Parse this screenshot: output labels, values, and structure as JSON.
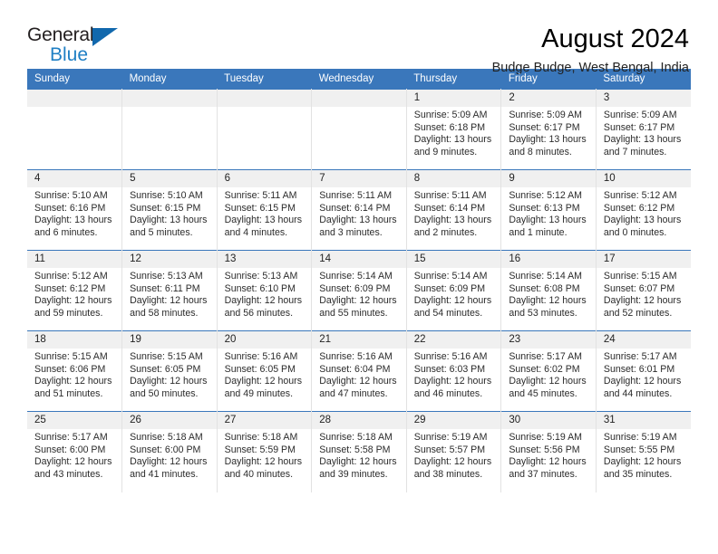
{
  "brand": {
    "line1": "General",
    "line2": "Blue",
    "triangle_color": "#1168ad",
    "blue_text_color": "#1f7fc4"
  },
  "header": {
    "title": "August 2024",
    "subtitle": "Budge Budge, West Bengal, India",
    "header_bg": "#3a77bb",
    "daynum_bg": "#f0f0f0"
  },
  "weekdays": [
    "Sunday",
    "Monday",
    "Tuesday",
    "Wednesday",
    "Thursday",
    "Friday",
    "Saturday"
  ],
  "weeks": [
    [
      {
        "day": "",
        "sunrise": "",
        "sunset": "",
        "daylight1": "",
        "daylight2": ""
      },
      {
        "day": "",
        "sunrise": "",
        "sunset": "",
        "daylight1": "",
        "daylight2": ""
      },
      {
        "day": "",
        "sunrise": "",
        "sunset": "",
        "daylight1": "",
        "daylight2": ""
      },
      {
        "day": "",
        "sunrise": "",
        "sunset": "",
        "daylight1": "",
        "daylight2": ""
      },
      {
        "day": "1",
        "sunrise": "Sunrise: 5:09 AM",
        "sunset": "Sunset: 6:18 PM",
        "daylight1": "Daylight: 13 hours",
        "daylight2": "and 9 minutes."
      },
      {
        "day": "2",
        "sunrise": "Sunrise: 5:09 AM",
        "sunset": "Sunset: 6:17 PM",
        "daylight1": "Daylight: 13 hours",
        "daylight2": "and 8 minutes."
      },
      {
        "day": "3",
        "sunrise": "Sunrise: 5:09 AM",
        "sunset": "Sunset: 6:17 PM",
        "daylight1": "Daylight: 13 hours",
        "daylight2": "and 7 minutes."
      }
    ],
    [
      {
        "day": "4",
        "sunrise": "Sunrise: 5:10 AM",
        "sunset": "Sunset: 6:16 PM",
        "daylight1": "Daylight: 13 hours",
        "daylight2": "and 6 minutes."
      },
      {
        "day": "5",
        "sunrise": "Sunrise: 5:10 AM",
        "sunset": "Sunset: 6:15 PM",
        "daylight1": "Daylight: 13 hours",
        "daylight2": "and 5 minutes."
      },
      {
        "day": "6",
        "sunrise": "Sunrise: 5:11 AM",
        "sunset": "Sunset: 6:15 PM",
        "daylight1": "Daylight: 13 hours",
        "daylight2": "and 4 minutes."
      },
      {
        "day": "7",
        "sunrise": "Sunrise: 5:11 AM",
        "sunset": "Sunset: 6:14 PM",
        "daylight1": "Daylight: 13 hours",
        "daylight2": "and 3 minutes."
      },
      {
        "day": "8",
        "sunrise": "Sunrise: 5:11 AM",
        "sunset": "Sunset: 6:14 PM",
        "daylight1": "Daylight: 13 hours",
        "daylight2": "and 2 minutes."
      },
      {
        "day": "9",
        "sunrise": "Sunrise: 5:12 AM",
        "sunset": "Sunset: 6:13 PM",
        "daylight1": "Daylight: 13 hours",
        "daylight2": "and 1 minute."
      },
      {
        "day": "10",
        "sunrise": "Sunrise: 5:12 AM",
        "sunset": "Sunset: 6:12 PM",
        "daylight1": "Daylight: 13 hours",
        "daylight2": "and 0 minutes."
      }
    ],
    [
      {
        "day": "11",
        "sunrise": "Sunrise: 5:12 AM",
        "sunset": "Sunset: 6:12 PM",
        "daylight1": "Daylight: 12 hours",
        "daylight2": "and 59 minutes."
      },
      {
        "day": "12",
        "sunrise": "Sunrise: 5:13 AM",
        "sunset": "Sunset: 6:11 PM",
        "daylight1": "Daylight: 12 hours",
        "daylight2": "and 58 minutes."
      },
      {
        "day": "13",
        "sunrise": "Sunrise: 5:13 AM",
        "sunset": "Sunset: 6:10 PM",
        "daylight1": "Daylight: 12 hours",
        "daylight2": "and 56 minutes."
      },
      {
        "day": "14",
        "sunrise": "Sunrise: 5:14 AM",
        "sunset": "Sunset: 6:09 PM",
        "daylight1": "Daylight: 12 hours",
        "daylight2": "and 55 minutes."
      },
      {
        "day": "15",
        "sunrise": "Sunrise: 5:14 AM",
        "sunset": "Sunset: 6:09 PM",
        "daylight1": "Daylight: 12 hours",
        "daylight2": "and 54 minutes."
      },
      {
        "day": "16",
        "sunrise": "Sunrise: 5:14 AM",
        "sunset": "Sunset: 6:08 PM",
        "daylight1": "Daylight: 12 hours",
        "daylight2": "and 53 minutes."
      },
      {
        "day": "17",
        "sunrise": "Sunrise: 5:15 AM",
        "sunset": "Sunset: 6:07 PM",
        "daylight1": "Daylight: 12 hours",
        "daylight2": "and 52 minutes."
      }
    ],
    [
      {
        "day": "18",
        "sunrise": "Sunrise: 5:15 AM",
        "sunset": "Sunset: 6:06 PM",
        "daylight1": "Daylight: 12 hours",
        "daylight2": "and 51 minutes."
      },
      {
        "day": "19",
        "sunrise": "Sunrise: 5:15 AM",
        "sunset": "Sunset: 6:05 PM",
        "daylight1": "Daylight: 12 hours",
        "daylight2": "and 50 minutes."
      },
      {
        "day": "20",
        "sunrise": "Sunrise: 5:16 AM",
        "sunset": "Sunset: 6:05 PM",
        "daylight1": "Daylight: 12 hours",
        "daylight2": "and 49 minutes."
      },
      {
        "day": "21",
        "sunrise": "Sunrise: 5:16 AM",
        "sunset": "Sunset: 6:04 PM",
        "daylight1": "Daylight: 12 hours",
        "daylight2": "and 47 minutes."
      },
      {
        "day": "22",
        "sunrise": "Sunrise: 5:16 AM",
        "sunset": "Sunset: 6:03 PM",
        "daylight1": "Daylight: 12 hours",
        "daylight2": "and 46 minutes."
      },
      {
        "day": "23",
        "sunrise": "Sunrise: 5:17 AM",
        "sunset": "Sunset: 6:02 PM",
        "daylight1": "Daylight: 12 hours",
        "daylight2": "and 45 minutes."
      },
      {
        "day": "24",
        "sunrise": "Sunrise: 5:17 AM",
        "sunset": "Sunset: 6:01 PM",
        "daylight1": "Daylight: 12 hours",
        "daylight2": "and 44 minutes."
      }
    ],
    [
      {
        "day": "25",
        "sunrise": "Sunrise: 5:17 AM",
        "sunset": "Sunset: 6:00 PM",
        "daylight1": "Daylight: 12 hours",
        "daylight2": "and 43 minutes."
      },
      {
        "day": "26",
        "sunrise": "Sunrise: 5:18 AM",
        "sunset": "Sunset: 6:00 PM",
        "daylight1": "Daylight: 12 hours",
        "daylight2": "and 41 minutes."
      },
      {
        "day": "27",
        "sunrise": "Sunrise: 5:18 AM",
        "sunset": "Sunset: 5:59 PM",
        "daylight1": "Daylight: 12 hours",
        "daylight2": "and 40 minutes."
      },
      {
        "day": "28",
        "sunrise": "Sunrise: 5:18 AM",
        "sunset": "Sunset: 5:58 PM",
        "daylight1": "Daylight: 12 hours",
        "daylight2": "and 39 minutes."
      },
      {
        "day": "29",
        "sunrise": "Sunrise: 5:19 AM",
        "sunset": "Sunset: 5:57 PM",
        "daylight1": "Daylight: 12 hours",
        "daylight2": "and 38 minutes."
      },
      {
        "day": "30",
        "sunrise": "Sunrise: 5:19 AM",
        "sunset": "Sunset: 5:56 PM",
        "daylight1": "Daylight: 12 hours",
        "daylight2": "and 37 minutes."
      },
      {
        "day": "31",
        "sunrise": "Sunrise: 5:19 AM",
        "sunset": "Sunset: 5:55 PM",
        "daylight1": "Daylight: 12 hours",
        "daylight2": "and 35 minutes."
      }
    ]
  ]
}
